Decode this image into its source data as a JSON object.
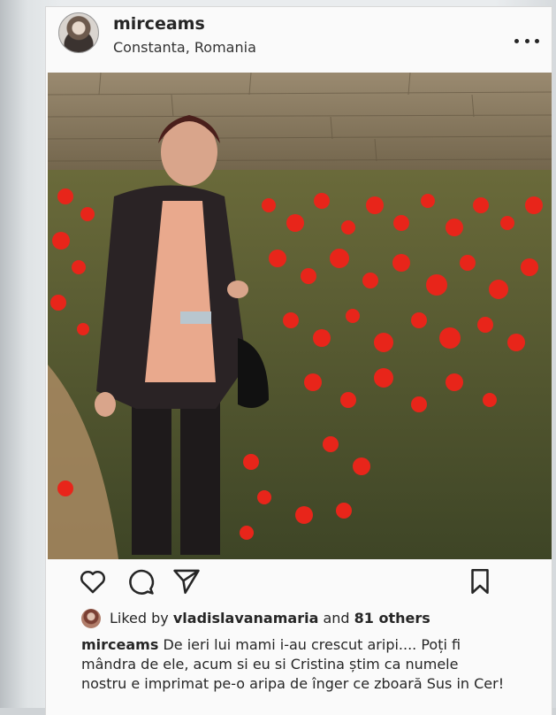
{
  "post": {
    "username": "mirceams",
    "location": "Constanta, Romania",
    "more_icon": "more-horizontal-icon"
  },
  "photo": {
    "description_colors": {
      "flowers": "#e8251a",
      "wall": "#8a7a60",
      "foliage": "#4f5a2c",
      "path": "#b08a5e"
    }
  },
  "actions": {
    "like_icon": "heart-icon",
    "comment_icon": "comment-icon",
    "share_icon": "send-icon",
    "save_icon": "bookmark-icon"
  },
  "likes": {
    "prefix": "Liked by",
    "user": "vladislavanamaria",
    "middle": "and",
    "others": "81 others"
  },
  "caption": {
    "author": "mirceams",
    "text": "De ieri lui mami i-au crescut aripi.... Poți fi mândra de ele, acum si eu si Cristina știm ca numele nostru e imprimat pe-o aripa de înger ce zboară Sus in Cer!"
  }
}
